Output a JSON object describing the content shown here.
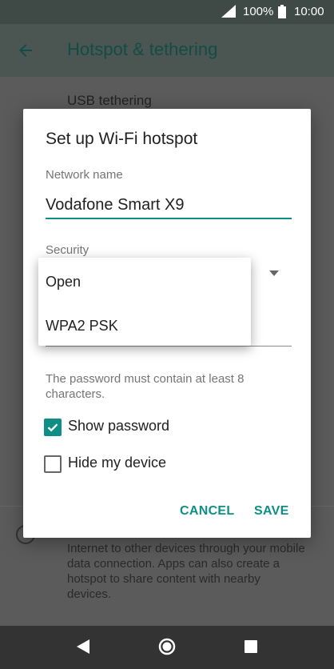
{
  "status_bar": {
    "battery_percent": "100%",
    "time": "10:00"
  },
  "app_bar": {
    "title": "Hotspot & tethering"
  },
  "background": {
    "usb_tethering": "USB tethering",
    "description": "Internet to other devices through your mobile data connection. Apps can also create a hotspot to share content with nearby devices."
  },
  "dialog": {
    "title": "Set up Wi-Fi hotspot",
    "network_name_label": "Network name",
    "network_name_value": "Vodafone Smart X9",
    "security_label": "Security",
    "password_hint": "The password must contain at least 8 characters.",
    "show_password_label": "Show password",
    "show_password_checked": true,
    "hide_device_label": "Hide my device",
    "hide_device_checked": false,
    "cancel_label": "CANCEL",
    "save_label": "SAVE"
  },
  "dropdown": {
    "options": [
      "Open",
      "WPA2 PSK"
    ]
  },
  "colors": {
    "accent": "#0e8f86"
  }
}
